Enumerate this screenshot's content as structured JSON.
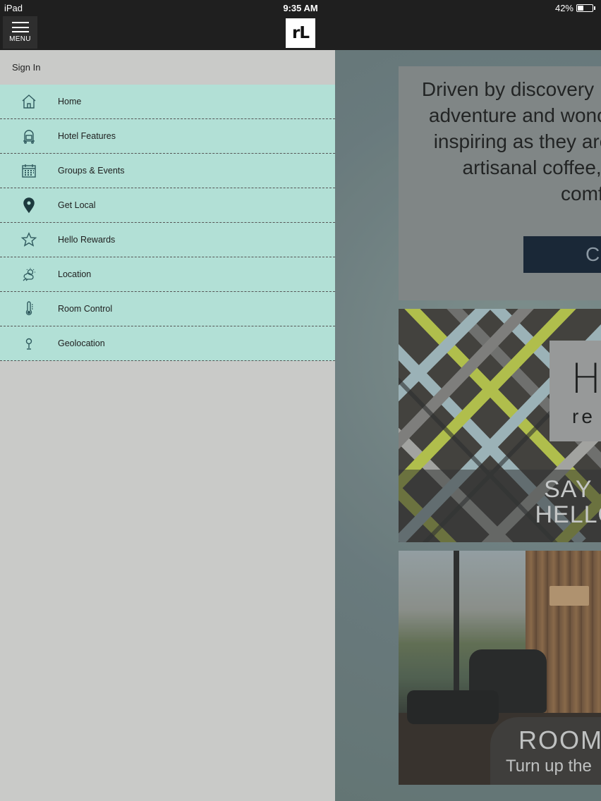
{
  "status_bar": {
    "device": "iPad",
    "time": "9:35 AM",
    "battery": "42%",
    "battery_level": 0.42
  },
  "header": {
    "menu_label": "MENU",
    "logo_text": "rL"
  },
  "sidebar": {
    "sign_in": "Sign In",
    "items": [
      {
        "label": "Home",
        "icon": "home-icon"
      },
      {
        "label": "Hotel Features",
        "icon": "luggage-cart-icon"
      },
      {
        "label": "Groups & Events",
        "icon": "calendar-icon"
      },
      {
        "label": "Get Local",
        "icon": "map-pin-icon"
      },
      {
        "label": "Hello Rewards",
        "icon": "star-icon"
      },
      {
        "label": "Location",
        "icon": "weather-icon"
      },
      {
        "label": "Room Control",
        "icon": "thermometer-icon"
      },
      {
        "label": "Geolocation",
        "icon": "location-pin-icon"
      }
    ]
  },
  "content": {
    "promo_lines": [
      "Driven by discovery",
      "adventure and wonc",
      "inspiring as they are",
      "artisanal coffee, c",
      "comfo"
    ],
    "promo_button": "C",
    "rewards_heading": "H",
    "rewards_sub": "re",
    "rewards_tag_lines": [
      "SAY H",
      "HELLO"
    ],
    "room_title": "ROOM",
    "room_sub": "Turn up the"
  },
  "colors": {
    "nav_bg": "#b2e0d6",
    "sidebar_bg": "#c9cac8",
    "header_bg": "#1f1f1f",
    "cta_bg": "#0c1a2b"
  }
}
